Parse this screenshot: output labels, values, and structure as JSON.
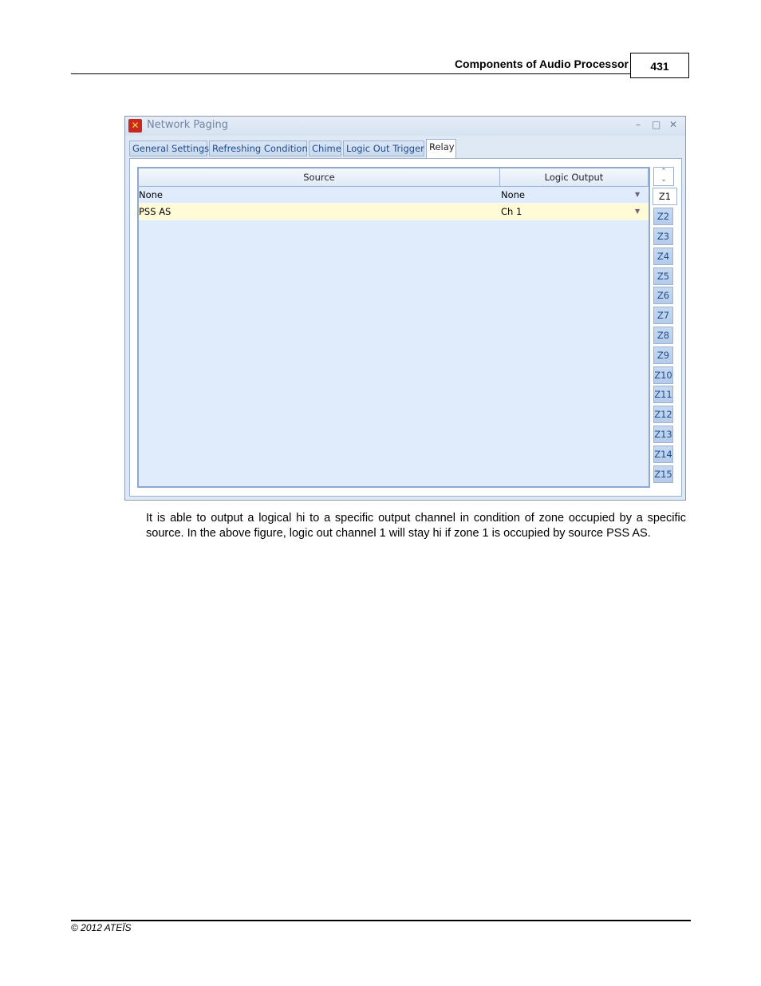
{
  "header": {
    "section_title": "Components of Audio Processor",
    "page_number": "431"
  },
  "window": {
    "title": "Network Paging",
    "controls": {
      "minimize": "–",
      "maximize": "□",
      "close": "✕"
    },
    "tabs": [
      {
        "label": "General Settings",
        "active": false
      },
      {
        "label": "Refreshing Condition",
        "active": false
      },
      {
        "label": "Chime",
        "active": false
      },
      {
        "label": "Logic Out Trigger",
        "active": false
      },
      {
        "label": "Relay",
        "active": true
      }
    ],
    "grid": {
      "columns": [
        "Source",
        "Logic Output"
      ],
      "rows": [
        {
          "source": "None",
          "logic_output": "None",
          "selected": false
        },
        {
          "source": "PSS AS",
          "logic_output": "Ch 1",
          "selected": true
        }
      ]
    },
    "scroll": {
      "up": "⌃",
      "down": "⌄"
    },
    "zones": [
      "Z1",
      "Z2",
      "Z3",
      "Z4",
      "Z5",
      "Z6",
      "Z7",
      "Z8",
      "Z9",
      "Z10",
      "Z11",
      "Z12",
      "Z13",
      "Z14",
      "Z15"
    ],
    "active_zone": "Z1"
  },
  "body_text": "It is able to output a logical hi to a specific output channel in condition of zone occupied by a specific source. In the above figure, logic out channel 1 will stay hi if zone 1 is occupied by source PSS AS.",
  "footer": {
    "copyright": "© 2012 ATEÏS"
  }
}
